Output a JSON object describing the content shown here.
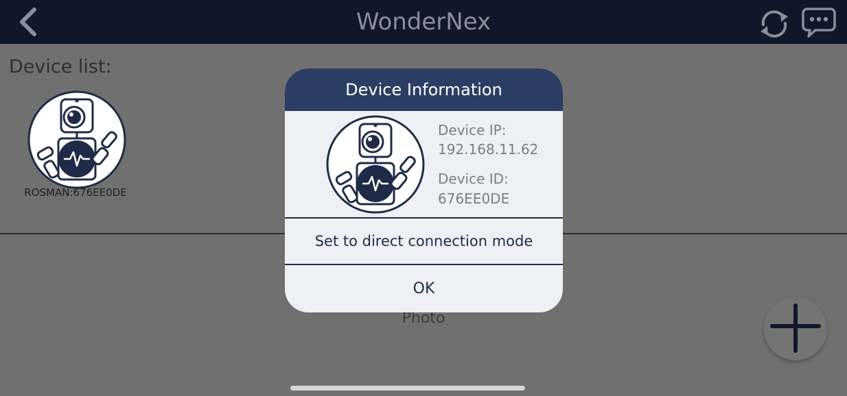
{
  "header": {
    "title": "WonderNex",
    "back_icon": "chevron-left-icon",
    "refresh_icon": "refresh-icon",
    "chat_icon": "chat-bubble-icon"
  },
  "main": {
    "device_list_title": "Device list:",
    "devices": [
      {
        "name": "ROSMAN:676EE0DE",
        "icon": "robot-icon"
      }
    ],
    "photo_label": "Photo",
    "add_icon": "plus-icon"
  },
  "dialog": {
    "title": "Device Information",
    "ip_label": "Device IP:",
    "ip_value": "192.168.11.62",
    "id_label": "Device ID:",
    "id_value": "676EE0DE",
    "direct_mode_label": "Set to direct connection mode",
    "ok_label": "OK"
  },
  "colors": {
    "header_bg": "#11172b",
    "dialog_header_bg": "#2c3e64",
    "accent": "#1f2b46",
    "overlay_bg": "#707070"
  }
}
